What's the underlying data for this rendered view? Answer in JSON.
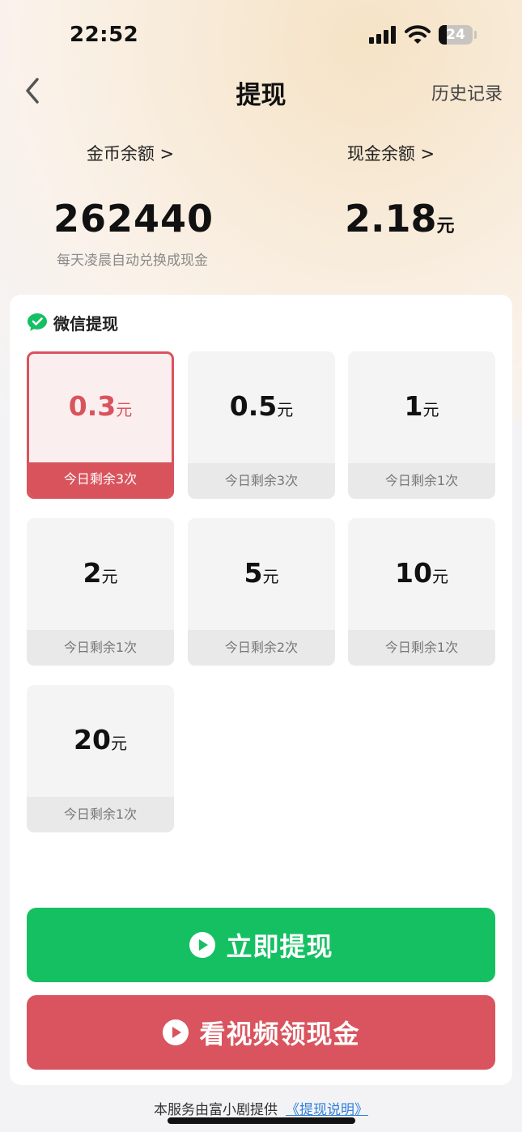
{
  "status_bar": {
    "time": "22:52",
    "battery": "24",
    "battery_level": 0.24
  },
  "header": {
    "title": "提现",
    "history": "历史记录"
  },
  "balances": {
    "coins_label": "金币余额 >",
    "coins_value": "262440",
    "coins_note": "每天凌晨自动兑换成现金",
    "cash_label": "现金余额 >",
    "cash_value": "2.18",
    "cash_unit": "元"
  },
  "withdraw": {
    "method_label": "微信提现",
    "selected_index": 0,
    "options": [
      {
        "amount": "0.3",
        "unit": "元",
        "remaining": "今日剩余3次"
      },
      {
        "amount": "0.5",
        "unit": "元",
        "remaining": "今日剩余3次"
      },
      {
        "amount": "1",
        "unit": "元",
        "remaining": "今日剩余1次"
      },
      {
        "amount": "2",
        "unit": "元",
        "remaining": "今日剩余1次"
      },
      {
        "amount": "5",
        "unit": "元",
        "remaining": "今日剩余2次"
      },
      {
        "amount": "10",
        "unit": "元",
        "remaining": "今日剩余1次"
      },
      {
        "amount": "20",
        "unit": "元",
        "remaining": "今日剩余1次"
      }
    ]
  },
  "buttons": {
    "withdraw_now": "立即提现",
    "watch_video": "看视频领现金"
  },
  "footer": {
    "provider_text": "本服务由富小剧提供",
    "link_text": "《提现说明》"
  },
  "colors": {
    "accent_red": "#d9535d",
    "wechat_green": "#15c063"
  }
}
